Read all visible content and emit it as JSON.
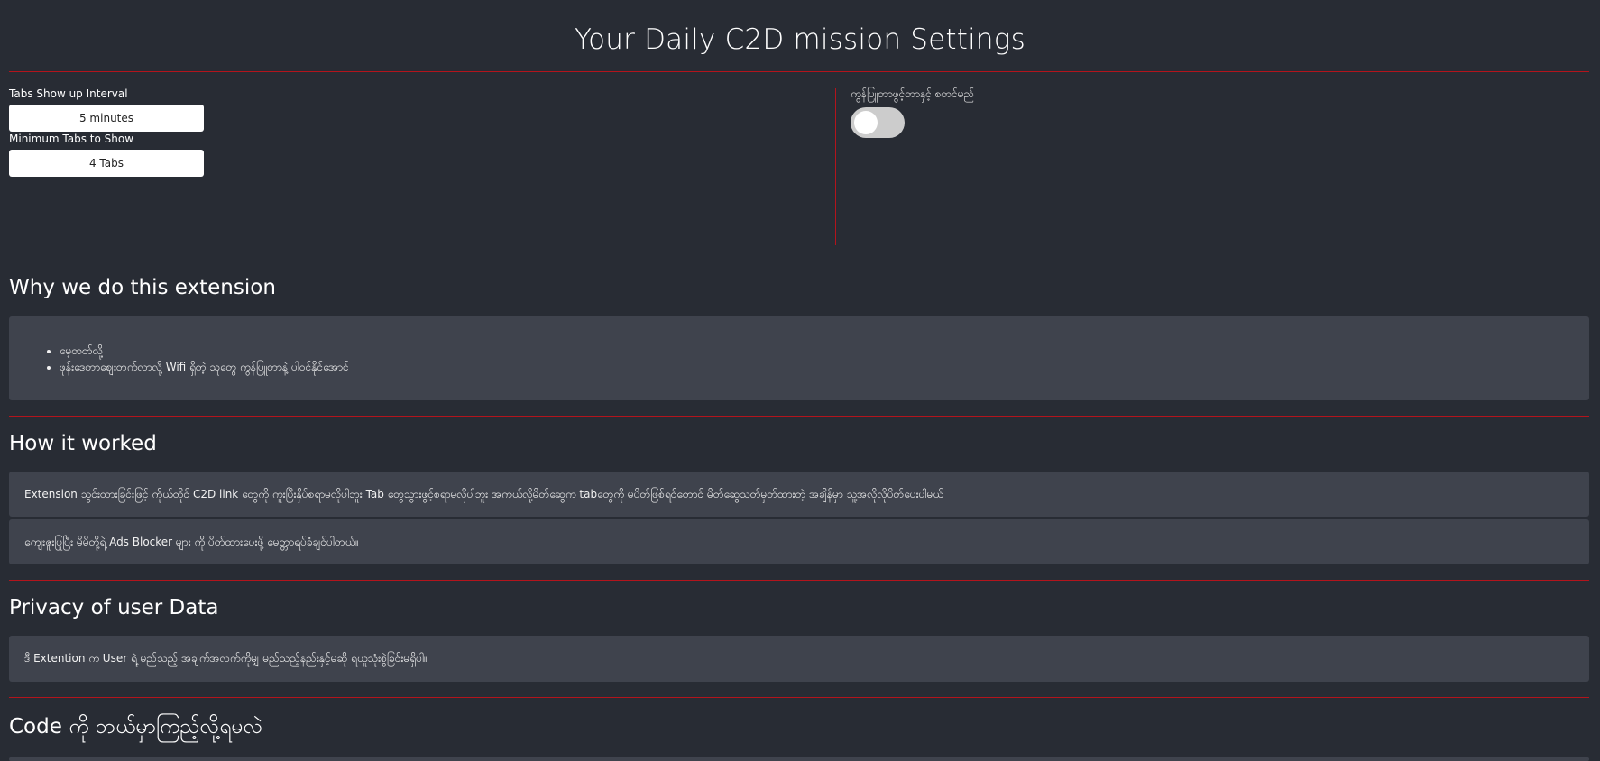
{
  "page": {
    "title": "Your Daily C2D mission Settings"
  },
  "settings": {
    "interval_label": "Tabs Show up Interval",
    "interval_value": "5 minutes",
    "min_tabs_label": "Minimum Tabs to Show",
    "min_tabs_value": "4 Tabs",
    "toggle_label": "ကွန်ပြူတာဖွင့်တာနှင့် စတင်မည်",
    "toggle_on": false
  },
  "why": {
    "heading": "Why we do this extension",
    "items": [
      "မေ့တတ်လို့",
      "ဖုန်းဒေတာဈေးတက်လာလို့ Wifi ရှိတဲ့ သူတွေ ကွန်ပြူတာနဲ့ ပါဝင်နိုင်အောင်"
    ]
  },
  "how": {
    "heading": "How it worked",
    "items": [
      "Extension သွင်းထားခြင်းဖြင့် ကိုယ်တိုင် C2D link တွေကို ကူးပြီးနှိပ်စရာမလိုပါဘူး Tab တွေသွားဖွင့်စရာမလိုပါဘူး အကယ်လို့မိတ်ဆွေက tabတွေကို မပိတ်ဖြစ်ရင်တောင် မိတ်ဆွေသတ်မှတ်ထားတဲ့ အချိန်မှာ သူ့အလိုလိုပိတ်ပေးပါမယ်",
      "ကျေးဇူးပြုပြီး မိမိတို့ရဲ့ Ads Blocker များ ကို ပိတ်ထားပေးဖို့ မေတ္တာရပ်ခံချင်ပါတယ်။"
    ]
  },
  "privacy": {
    "heading": "Privacy of user Data",
    "text": "ဒီ Extention က User ရဲ့ မည်သည့် အချက်အလက်ကိုမျှ မည်သည့်နည်းနှင့်မဆို ရယူသုံးစွဲခြင်းမရှိပါ။"
  },
  "code": {
    "heading": "Code ကို ဘယ်မှာကြည့်လို့ရမလဲ"
  },
  "colors": {
    "background": "#282c34",
    "card": "#3f434d",
    "divider": "#b3141c",
    "toggle_off": "#cccccc"
  }
}
